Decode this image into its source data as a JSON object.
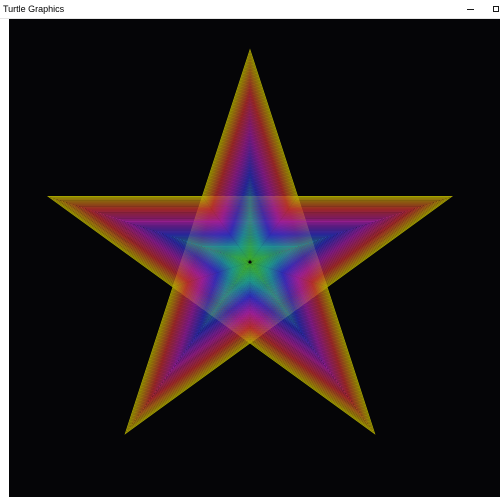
{
  "window": {
    "title": "Turtle Graphics"
  },
  "titlebar_buttons": {
    "minimize_icon": "minimize-icon",
    "maximize_icon": "maximize-icon"
  },
  "canvas": {
    "background": "#050507",
    "drawing": "nested-pentagram-star",
    "colors": [
      "#b8b400",
      "#c03030",
      "#a020a0",
      "#3030c0",
      "#20a090",
      "#40b030"
    ]
  }
}
